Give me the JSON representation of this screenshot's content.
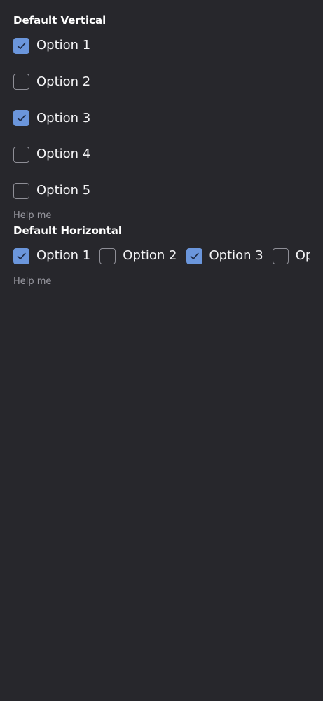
{
  "vertical_group": {
    "label": "Default Vertical",
    "options": [
      {
        "label": "Option 1",
        "checked": true
      },
      {
        "label": "Option 2",
        "checked": false
      },
      {
        "label": "Option 3",
        "checked": true
      },
      {
        "label": "Option 4",
        "checked": false
      },
      {
        "label": "Option 5",
        "checked": false
      }
    ],
    "help": "Help me"
  },
  "horizontal_group": {
    "label": "Default Horizontal",
    "options": [
      {
        "label": "Option 1",
        "checked": true
      },
      {
        "label": "Option 2",
        "checked": false
      },
      {
        "label": "Option 3",
        "checked": true
      },
      {
        "label": "Op",
        "checked": false
      }
    ],
    "help": "Help me"
  },
  "colors": {
    "background": "#27272c",
    "accent": "#6b96dc",
    "unchecked_border": "#8e8e96",
    "help_text": "#9a9aa2"
  },
  "icons": {
    "checked": "checkmark-icon"
  }
}
